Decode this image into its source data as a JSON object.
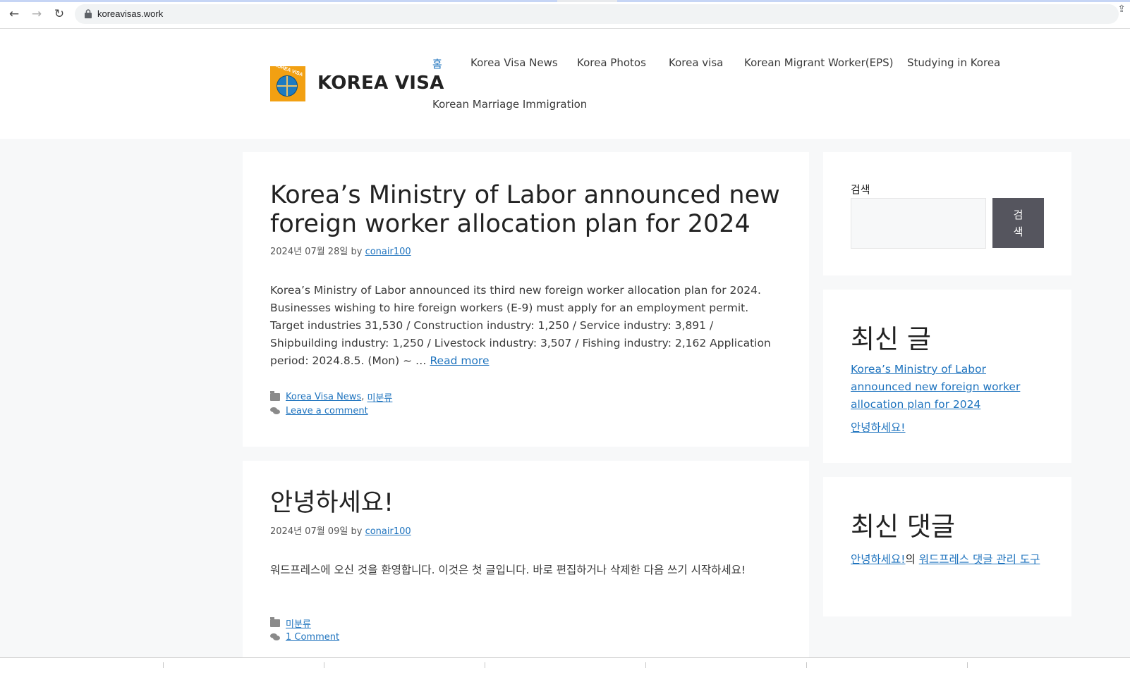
{
  "browser": {
    "url": "koreavisas.work",
    "back_icon": "←",
    "forward_icon": "→",
    "reload_icon": "↻",
    "share_icon": "⇪"
  },
  "site": {
    "title": "KOREA VISA",
    "logo_text": "KOREA VISA",
    "menu": [
      "홈",
      "Korea Visa News",
      "Korea Photos",
      "Korea visa",
      "Korean Migrant Worker(EPS)",
      "Studying in Korea",
      "Korean Marriage Immigration"
    ]
  },
  "posts": [
    {
      "title_line1": "Korea’s Ministry of Labor announced new",
      "title_line2": "foreign worker allocation plan for 2024",
      "date": "2024년 07월 28일",
      "by": "by",
      "author": "conair100",
      "excerpt": "Korea’s Ministry of Labor announced its third new foreign worker allocation plan for 2024. Businesses wishing to hire foreign workers (E-9) must apply for an employment permit. Target industries 31,530 / Construction industry: 1,250 / Service industry: 3,891 / Shipbuilding industry: 1,250 / Livestock industry: 3,507 / Fishing industry: 2,162 Application period: 2024.8.5. (Mon) ~ …",
      "read_more": "Read more",
      "categories": [
        "Korea Visa News",
        "미분류"
      ],
      "comments_link": "Leave a comment"
    },
    {
      "title": "안녕하세요!",
      "date": "2024년 07월 09일",
      "by": "by",
      "author": "conair100",
      "excerpt": "워드프레스에 오신 것을 환영합니다. 이것은 첫 글입니다. 바로 편집하거나 삭제한 다음 쓰기 시작하세요!",
      "categories": [
        "미분류"
      ],
      "comments_link": "1 Comment"
    }
  ],
  "sidebar": {
    "search_label": "검색",
    "search_button": "검색",
    "recent_posts_title": "최신 글",
    "recent_posts": [
      "Korea’s Ministry of Labor announced new foreign worker allocation plan for 2024",
      "안녕하세요!"
    ],
    "recent_comments_title": "최신 댓글",
    "recent_comment": {
      "post": "안녕하세요!",
      "connector": "의",
      "author": "워드프레스 댓글 관리 도구"
    }
  },
  "colors": {
    "link": "#1e73be",
    "background": "#f7f8f9",
    "search_button": "#55555e",
    "logo_bg": "#f2a012"
  }
}
